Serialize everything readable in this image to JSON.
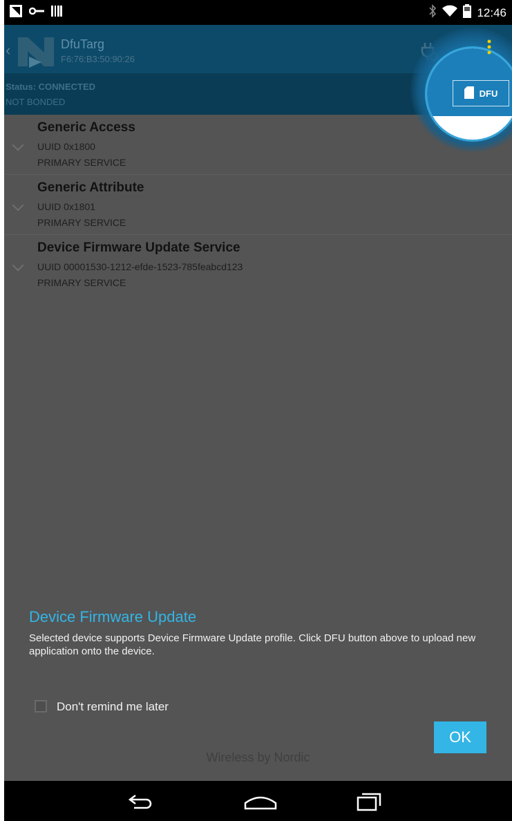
{
  "status_bar": {
    "time": "12:46",
    "left_icons": [
      "notification-icon",
      "key-icon",
      "barcode-icon"
    ],
    "right_icons": [
      "bluetooth-icon",
      "wifi-icon",
      "battery-icon"
    ]
  },
  "action_bar": {
    "title": "DfuTarg",
    "subtitle": "F6:76:B3:50:90:26",
    "connect_icon": "plug-icon",
    "menu_icon": "overflow-menu-icon"
  },
  "connection": {
    "status": "Status: CONNECTED",
    "bond": "NOT BONDED"
  },
  "services": [
    {
      "name": "Generic Access",
      "uuid": "UUID 0x1800",
      "type": "PRIMARY SERVICE"
    },
    {
      "name": "Generic Attribute",
      "uuid": "UUID 0x1801",
      "type": "PRIMARY SERVICE"
    },
    {
      "name": "Device Firmware Update Service",
      "uuid": "UUID 00001530-1212-efde-1523-785feabcd123",
      "type": "PRIMARY SERVICE"
    }
  ],
  "dfu_button": {
    "label": "DFU"
  },
  "dialog": {
    "title": "Device Firmware Update",
    "message": "Selected device supports Device Firmware Update profile. Click DFU button above to upload new application onto the device.",
    "checkbox_label": "Don't remind me later",
    "checkbox_checked": false,
    "ok_label": "OK"
  },
  "footer": {
    "text": "Wireless by Nordic"
  },
  "colors": {
    "accent": "#33b5e5",
    "action_bar": "#0d4a6a",
    "dfu_blue": "#1c7fb9"
  }
}
